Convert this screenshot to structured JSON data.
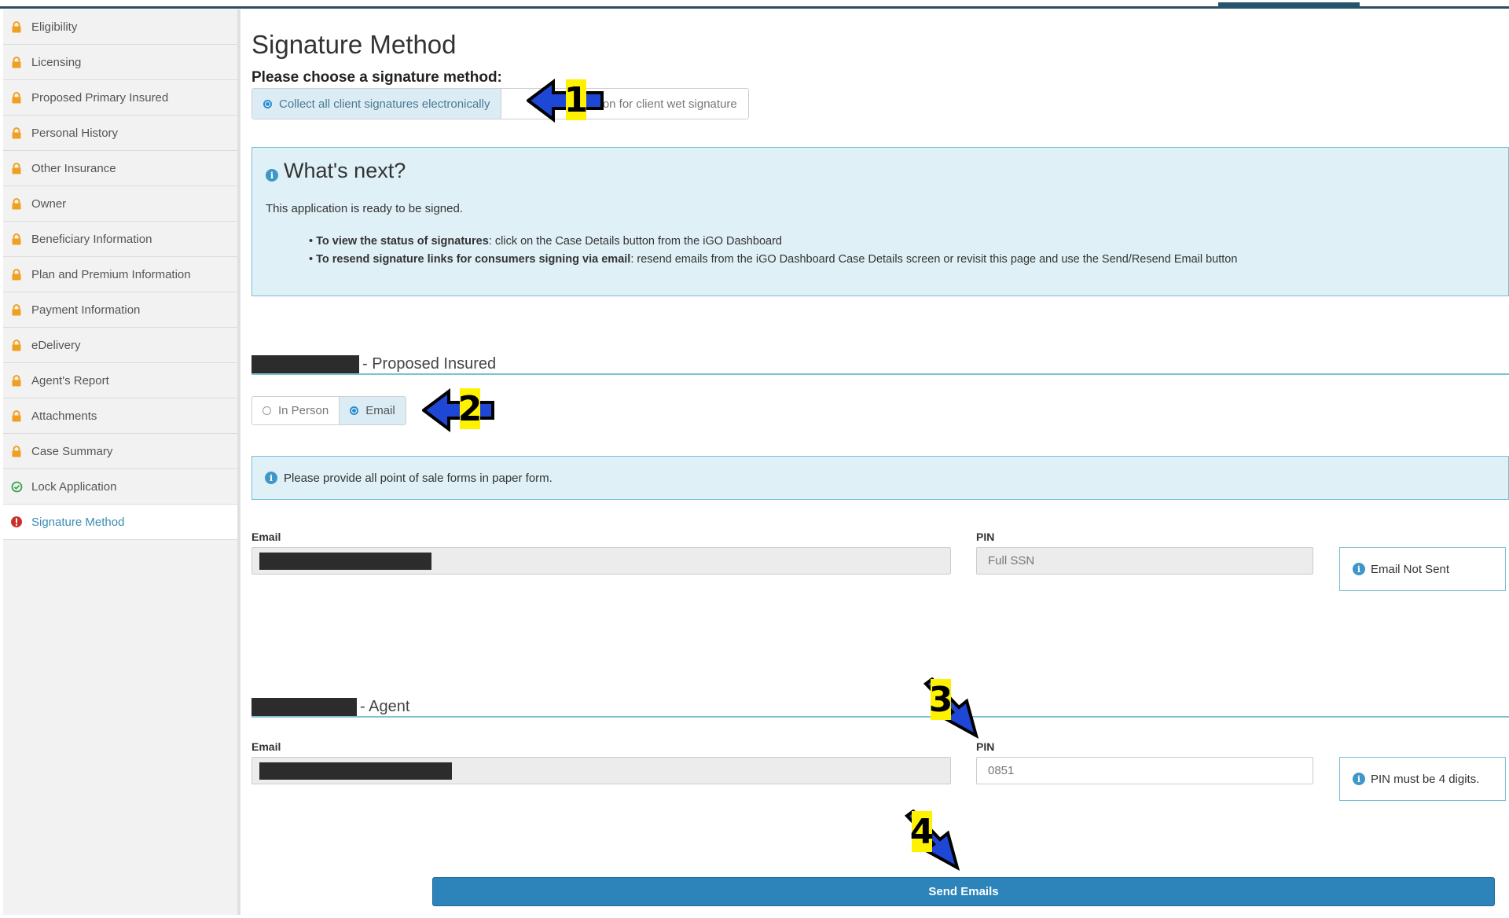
{
  "sidebar": {
    "items": [
      {
        "label": "Eligibility",
        "icon": "lock-icon"
      },
      {
        "label": "Licensing",
        "icon": "lock-icon"
      },
      {
        "label": "Proposed Primary Insured",
        "icon": "lock-icon"
      },
      {
        "label": "Personal History",
        "icon": "lock-icon"
      },
      {
        "label": "Other Insurance",
        "icon": "lock-icon"
      },
      {
        "label": "Owner",
        "icon": "lock-icon"
      },
      {
        "label": "Beneficiary Information",
        "icon": "lock-icon"
      },
      {
        "label": "Plan and Premium Information",
        "icon": "lock-icon"
      },
      {
        "label": "Payment Information",
        "icon": "lock-icon"
      },
      {
        "label": "eDelivery",
        "icon": "lock-icon"
      },
      {
        "label": "Agent's Report",
        "icon": "lock-icon"
      },
      {
        "label": "Attachments",
        "icon": "lock-icon"
      },
      {
        "label": "Case Summary",
        "icon": "lock-icon"
      },
      {
        "label": "Lock Application",
        "icon": "check-circle-icon"
      },
      {
        "label": "Signature Method",
        "icon": "alert-circle-icon"
      }
    ]
  },
  "main": {
    "title": "Signature Method",
    "choose_label": "Please choose a signature method:",
    "method_options": {
      "electronic": "Collect all client signatures electronically",
      "wet": "plication for client wet signature"
    },
    "whats_next": {
      "heading": "What's next?",
      "intro": "This application is ready to be signed.",
      "bullet1_bold": "To view the status of signatures",
      "bullet1_rest": ": click on the Case Details button from the iGO Dashboard",
      "bullet2_bold": "To resend signature links for consumers signing via email",
      "bullet2_rest": ": resend emails from the iGO Dashboard Case Details screen or revisit this page and use the Send/Resend Email button"
    },
    "insured": {
      "suffix": "- Proposed Insured",
      "option_in_person": "In Person",
      "option_email": "Email",
      "notice": "Please provide all point of sale forms in paper form.",
      "email_label": "Email",
      "pin_label": "PIN",
      "pin_value": "Full SSN",
      "status": "Email Not Sent"
    },
    "agent": {
      "suffix": "- Agent",
      "email_label": "Email",
      "pin_label": "PIN",
      "pin_value": "0851",
      "status": "PIN must be 4 digits."
    },
    "send_button": "Send Emails"
  },
  "annotations": {
    "badge1": "1",
    "badge2": "2",
    "badge3": "3",
    "badge4": "4",
    "arrow_color": "#1f47d6",
    "badge_color": "#fff200"
  },
  "colors": {
    "accent": "#2c84bb",
    "info_bg": "#dff0f6",
    "lock": "#f0a020",
    "check": "#3aa34a",
    "alert": "#c9302c"
  }
}
